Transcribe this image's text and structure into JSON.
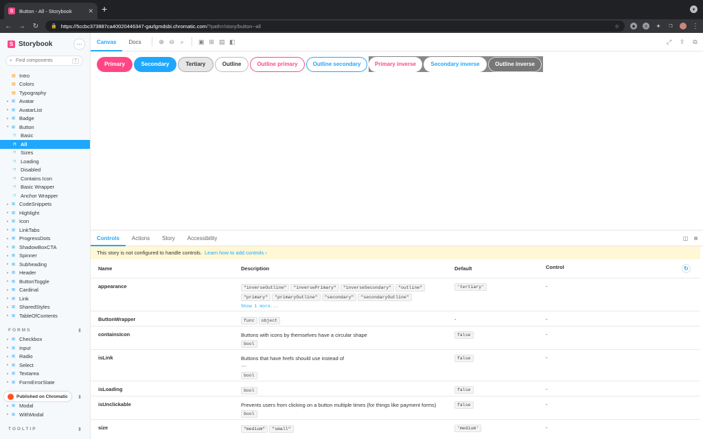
{
  "browser": {
    "tab_title": "Button - All - Storybook",
    "tab_close": "✕",
    "new_tab": "+",
    "url_host": "https://5ccbc373887ca40020446347-gazlgmdsbi.chromatic.com",
    "url_path": "/?path=/story/button--all",
    "nav_back": "←",
    "nav_forward": "→",
    "nav_reload": "↻"
  },
  "sidebar": {
    "brand": "Storybook",
    "menu": "···",
    "search_placeholder": "Find components",
    "search_key": "/",
    "items": [
      {
        "label": "Intro",
        "kind": "doc",
        "depth": 0
      },
      {
        "label": "Colors",
        "kind": "doc",
        "depth": 0
      },
      {
        "label": "Typography",
        "kind": "doc",
        "depth": 0
      },
      {
        "label": "Avatar",
        "kind": "comp",
        "depth": 0
      },
      {
        "label": "AvatarList",
        "kind": "comp",
        "depth": 0
      },
      {
        "label": "Badge",
        "kind": "comp",
        "depth": 0
      },
      {
        "label": "Button",
        "kind": "comp",
        "depth": 0,
        "open": true
      },
      {
        "label": "Basic",
        "kind": "story",
        "depth": 1
      },
      {
        "label": "All",
        "kind": "story",
        "depth": 1,
        "selected": true
      },
      {
        "label": "Sizes",
        "kind": "story",
        "depth": 1
      },
      {
        "label": "Loading",
        "kind": "story",
        "depth": 1
      },
      {
        "label": "Disabled",
        "kind": "story",
        "depth": 1
      },
      {
        "label": "Contains Icon",
        "kind": "story",
        "depth": 1
      },
      {
        "label": "Basic Wrapper",
        "kind": "story",
        "depth": 1
      },
      {
        "label": "Anchor Wrapper",
        "kind": "story",
        "depth": 1
      },
      {
        "label": "CodeSnippets",
        "kind": "comp",
        "depth": 0
      },
      {
        "label": "Highlight",
        "kind": "comp",
        "depth": 0
      },
      {
        "label": "Icon",
        "kind": "comp",
        "depth": 0
      },
      {
        "label": "LinkTabs",
        "kind": "comp",
        "depth": 0
      },
      {
        "label": "ProgressDots",
        "kind": "comp",
        "depth": 0
      },
      {
        "label": "ShadowBoxCTA",
        "kind": "comp",
        "depth": 0
      },
      {
        "label": "Spinner",
        "kind": "comp",
        "depth": 0
      },
      {
        "label": "Subheading",
        "kind": "comp",
        "depth": 0
      },
      {
        "label": "Header",
        "kind": "comp",
        "depth": 0
      },
      {
        "label": "ButtonToggle",
        "kind": "comp",
        "depth": 0
      },
      {
        "label": "Cardinal",
        "kind": "comp",
        "depth": 0
      },
      {
        "label": "Link",
        "kind": "comp",
        "depth": 0
      },
      {
        "label": "SharedStyles",
        "kind": "comp",
        "depth": 0
      },
      {
        "label": "TableOfContents",
        "kind": "comp",
        "depth": 0
      }
    ],
    "sections": [
      {
        "title": "FORMS",
        "items": [
          "Checkbox",
          "Input",
          "Radio",
          "Select",
          "Textarea",
          "FormErrorState"
        ]
      },
      {
        "title": "MODAL",
        "items": [
          "Modal",
          "WithModal"
        ]
      },
      {
        "title": "TOOLTIP",
        "items": []
      }
    ],
    "chromatic_badge": "Published on Chromatic"
  },
  "toolbar": {
    "tabs": [
      "Canvas",
      "Docs"
    ],
    "active_tab": "Canvas"
  },
  "buttons": [
    {
      "label": "Primary",
      "cls": "b-primary"
    },
    {
      "label": "Secondary",
      "cls": "b-secondary"
    },
    {
      "label": "Tertiary",
      "cls": "b-tertiary"
    },
    {
      "label": "Outline",
      "cls": "b-outline"
    },
    {
      "label": "Outline primary",
      "cls": "b-op"
    },
    {
      "label": "Outline secondary",
      "cls": "b-os"
    }
  ],
  "inverse_buttons": [
    {
      "label": "Primary inverse",
      "cls": "b-pi"
    },
    {
      "label": "Secondary inverse",
      "cls": "b-si"
    },
    {
      "label": "Outline inverse",
      "cls": "b-oi"
    }
  ],
  "addons": {
    "tabs": [
      "Controls",
      "Actions",
      "Story",
      "Accessibility"
    ],
    "active_tab": "Controls",
    "notice": "This story is not configured to handle controls.",
    "notice_link": "Learn how to add controls ›",
    "columns": {
      "name": "Name",
      "description": "Description",
      "default": "Default",
      "control": "Control"
    },
    "rows": [
      {
        "name": "appearance",
        "desc": "",
        "codes": [
          "\"inverseOutline\"",
          "\"inversePrimary\"",
          "\"inverseSecondary\"",
          "\"outline\"",
          "\"primary\"",
          "\"primaryOutline\"",
          "\"secondary\"",
          "\"secondaryOutline\""
        ],
        "more": "Show 1 more...",
        "default_code": "'tertiary'",
        "control": "-"
      },
      {
        "name": "ButtonWrapper",
        "desc": "",
        "codes": [
          "func",
          "object"
        ],
        "default_text": "-",
        "control": "-"
      },
      {
        "name": "containsIcon",
        "desc": "Buttons with icons by themselves have a circular shape",
        "codes": [
          "bool"
        ],
        "default_code": "false",
        "control": "-"
      },
      {
        "name": "isLink",
        "desc": "Buttons that have hrefs should use instead of",
        "desc_code": " ",
        "codes": [
          "bool"
        ],
        "default_code": "false",
        "control": "-"
      },
      {
        "name": "isLoading",
        "desc": "",
        "codes": [
          "bool"
        ],
        "default_code": "false",
        "control": "-"
      },
      {
        "name": "isUnclickable",
        "desc": "Prevents users from clicking on a button multiple times (for things like payment forms)",
        "codes": [
          "bool"
        ],
        "default_code": "false",
        "control": "-"
      },
      {
        "name": "size",
        "desc": "",
        "codes": [
          "\"medium\"",
          "\"small\""
        ],
        "default_code": "'medium'",
        "control": "-"
      }
    ]
  },
  "colors": {
    "pink": "#ff4785",
    "blue": "#1ea7fd"
  }
}
